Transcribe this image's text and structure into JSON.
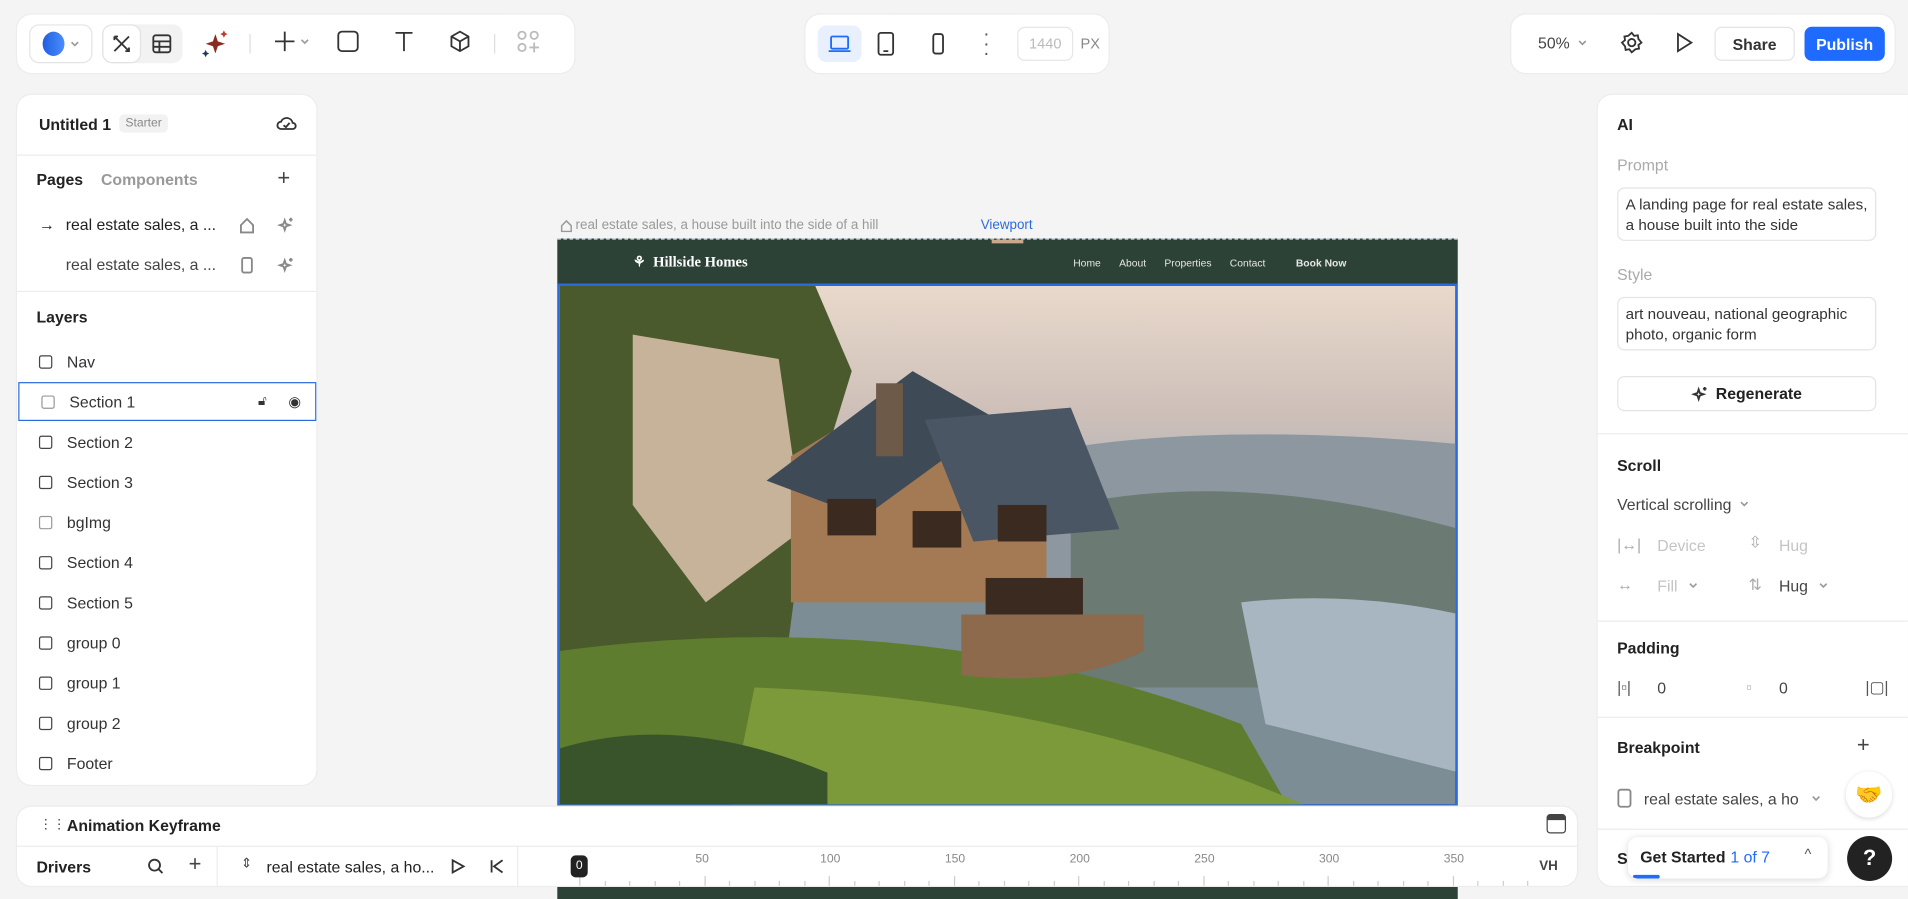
{
  "toolbar_left": {
    "icons": [
      "logo-icon",
      "chevron-down-icon",
      "design-tools-icon",
      "table-icon",
      "ai-sparkle-icon",
      "plus-icon",
      "rectangle-icon",
      "text-icon",
      "cube-icon",
      "components-add-icon"
    ]
  },
  "toolbar_center": {
    "width_value": "1440",
    "unit": "PX",
    "icons": [
      "desktop-icon",
      "tablet-icon",
      "mobile-icon",
      "more-icon"
    ]
  },
  "toolbar_right": {
    "zoom": "50%",
    "share": "Share",
    "publish": "Publish",
    "accent": "#1f6bff"
  },
  "left_panel": {
    "title": "Untitled 1",
    "badge": "Starter",
    "tabs": [
      "Pages",
      "Components"
    ],
    "pages": [
      {
        "label": "real estate sales, a ..."
      },
      {
        "label": "real estate sales, a ..."
      }
    ],
    "layers_title": "Layers",
    "layers": [
      "Nav",
      "Section 1",
      "Section 2",
      "Section 3",
      "bgImg",
      "Section 4",
      "Section 5",
      "group 0",
      "group 1",
      "group 2",
      "Footer"
    ]
  },
  "canvas": {
    "page_label": "real estate sales, a house built into the side of a hill",
    "viewport_label": "Viewport",
    "site": {
      "brand": "Hillside Homes",
      "nav": [
        "Home",
        "About",
        "Properties",
        "Contact"
      ],
      "cta": "Book Now",
      "nav_bg": "#2c4236"
    }
  },
  "right_panel": {
    "ai_title": "AI",
    "prompt_label": "Prompt",
    "prompt_value": "A landing page for real estate sales, a house built into the side",
    "style_label": "Style",
    "style_value": "art nouveau, national geographic photo, organic form",
    "regenerate": "Regenerate",
    "scroll_title": "Scroll",
    "scroll_mode": "Vertical scrolling",
    "width_mode": "Device",
    "height_mode": "Hug",
    "fill": "Fill",
    "hug": "Hug",
    "padding_title": "Padding",
    "pad_h": "0",
    "pad_v": "0",
    "breakpoint_title": "Breakpoint",
    "breakpoint_value": "real estate sales, a ho",
    "s_label": "S"
  },
  "timeline": {
    "title": "Animation Keyframe",
    "drivers": "Drivers",
    "driver_value": "real estate sales, a ho...",
    "playhead": "0",
    "ticks": [
      "50",
      "100",
      "150",
      "200",
      "250",
      "300",
      "350"
    ],
    "unit": "VH"
  },
  "get_started": {
    "label": "Get Started",
    "progress": "1 of 7",
    "help": "?",
    "progress_fraction": 0.14
  }
}
